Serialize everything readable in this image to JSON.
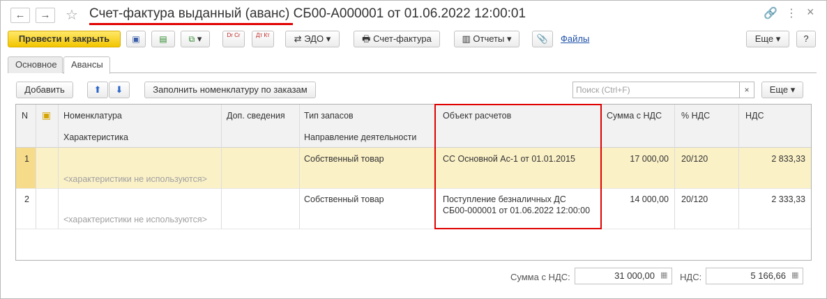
{
  "window": {
    "title": "Счет-фактура выданный (аванс) СБ00-А000001 от 01.06.2022 12:00:01",
    "nav_back": "←",
    "nav_forward": "→",
    "star": "☆",
    "link_icon": "🔗",
    "more_icon": "⋮",
    "close_icon": "×"
  },
  "toolbar": {
    "post_close": "Провести и закрыть",
    "dtkt_1": "Dr Cr",
    "dtkt_2": "Дт Кт",
    "edo": "ЭДО",
    "invoice": "Счет-фактура",
    "reports": "Отчеты",
    "files": "Файлы",
    "more": "Еще",
    "help": "?",
    "dropdown_arrow": "▾"
  },
  "tabs": [
    {
      "label": "Основное"
    },
    {
      "label": "Авансы"
    }
  ],
  "table_toolbar": {
    "add": "Добавить",
    "up": "⬆",
    "down": "⬇",
    "fill": "Заполнить номенклатуру по заказам",
    "search_placeholder": "Поиск (Ctrl+F)",
    "clear": "×",
    "more": "Еще"
  },
  "columns": {
    "n": "N",
    "nomenclature": "Номенклатура",
    "characteristic": "Характеристика",
    "extra": "Доп. сведения",
    "stock_type": "Тип запасов",
    "direction": "Направление деятельности",
    "settlement": "Объект расчетов",
    "sum_vat": "Сумма с НДС",
    "vat_rate": "% НДС",
    "vat": "НДС"
  },
  "rows": [
    {
      "n": "1",
      "characteristic": "<характеристики не используются>",
      "stock_type": "Собственный товар",
      "settlement_1": "СС Основной Ас-1 от 01.01.2015",
      "settlement_2": "",
      "sum_vat": "17 000,00",
      "vat_rate": "20/120",
      "vat": "2 833,33"
    },
    {
      "n": "2",
      "characteristic": "<характеристики не используются>",
      "stock_type": "Собственный товар",
      "settlement_1": "Поступление безналичных ДС",
      "settlement_2": "СБ00-000001 от 01.06.2022 12:00:00",
      "sum_vat": "14 000,00",
      "vat_rate": "20/120",
      "vat": "2 333,33"
    }
  ],
  "footer": {
    "sum_label": "Сумма с НДС:",
    "sum_value": "31 000,00",
    "vat_label": "НДС:",
    "vat_value": "5 166,66"
  },
  "colors": {
    "primary_button": "#f2c500",
    "selected_row": "#fbf1c7",
    "highlight": "#e00000",
    "link": "#1c4fa8"
  }
}
